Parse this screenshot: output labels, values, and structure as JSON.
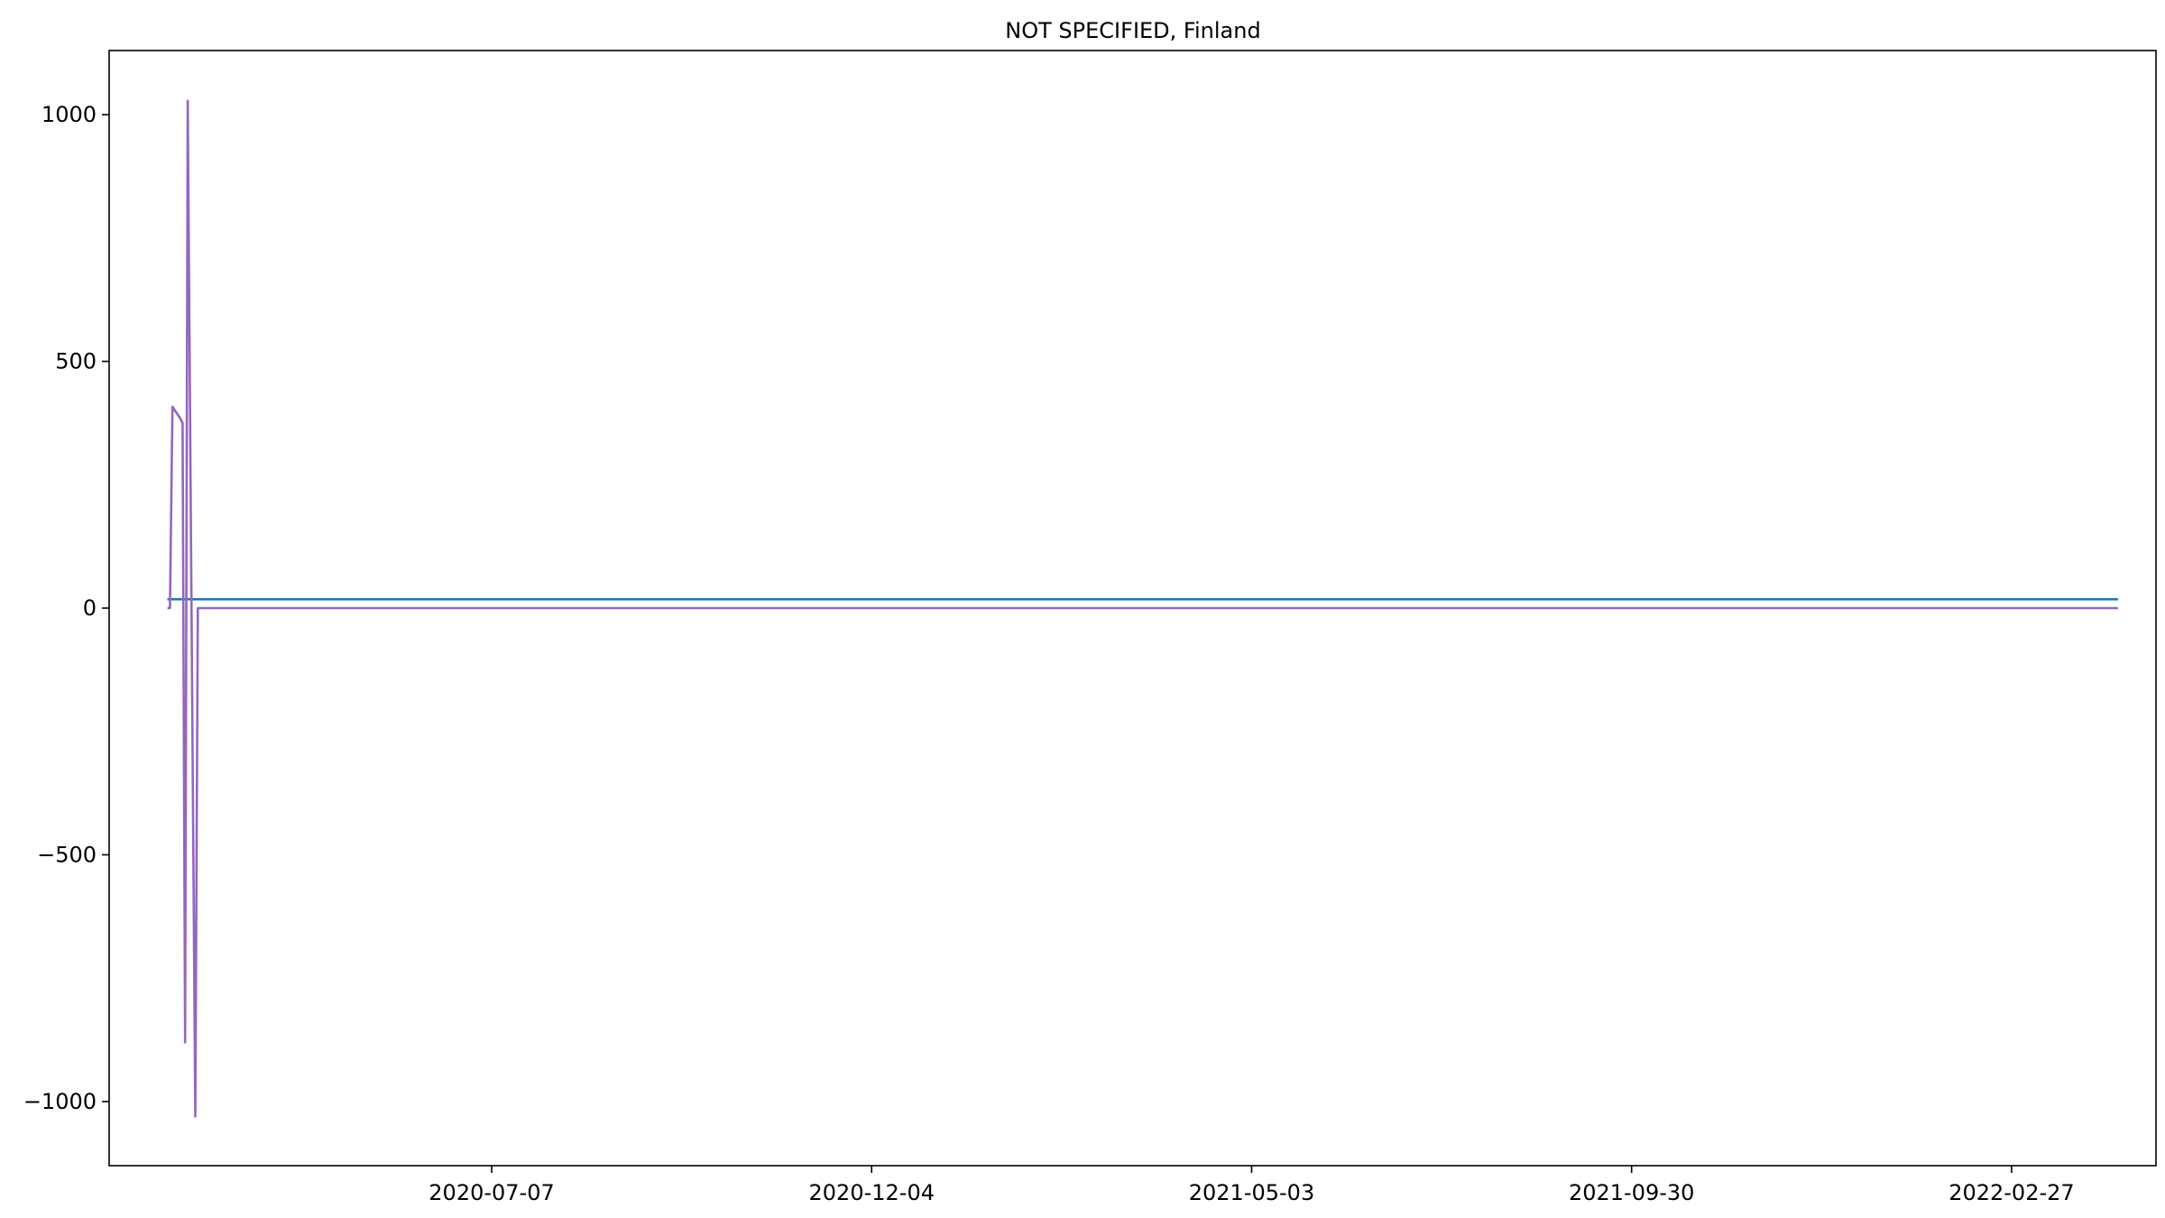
{
  "chart_data": {
    "type": "line",
    "title": "NOT SPECIFIED, Finland",
    "xlabel": "",
    "ylabel": "",
    "x_range": [
      "2020-02-07",
      "2022-04-25"
    ],
    "ylim": [
      -1130,
      1130
    ],
    "x_ticks": [
      "2020-07-07",
      "2020-12-04",
      "2021-05-03",
      "2021-09-30",
      "2022-02-27"
    ],
    "y_ticks": [
      1000,
      500,
      0,
      -500,
      -1000
    ],
    "y_tick_labels": [
      "1000",
      "500",
      "0",
      "−500",
      "−1000"
    ],
    "grid": false,
    "legend": "none",
    "series": [
      {
        "color": "#1f77b4",
        "points": [
          [
            "2020-03-01",
            18
          ],
          [
            "2022-04-10",
            18
          ]
        ]
      },
      {
        "color": "#9467bd",
        "points": [
          [
            "2020-03-01",
            0
          ],
          [
            "2020-03-02",
            0
          ],
          [
            "2020-03-03",
            408
          ],
          [
            "2020-03-06",
            385
          ],
          [
            "2020-03-07",
            375
          ],
          [
            "2020-03-08",
            -880
          ],
          [
            "2020-03-09",
            1028
          ],
          [
            "2020-03-12",
            -1030
          ],
          [
            "2020-03-13",
            0
          ],
          [
            "2022-04-10",
            0
          ]
        ]
      }
    ]
  }
}
